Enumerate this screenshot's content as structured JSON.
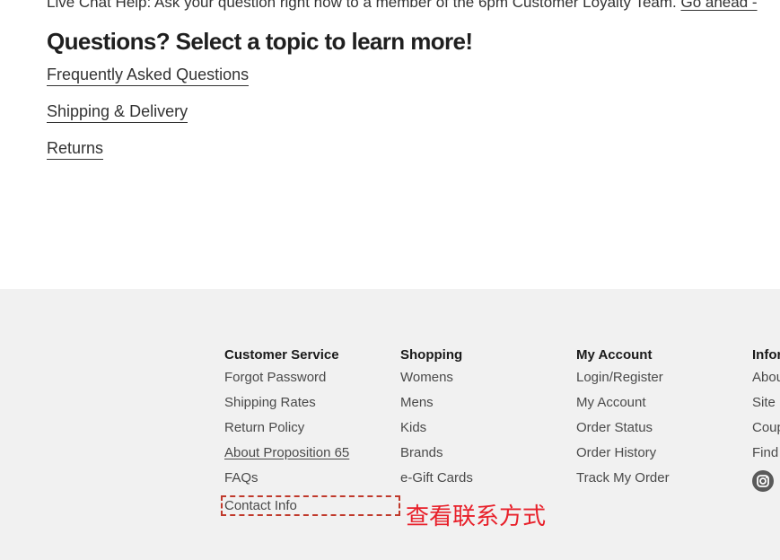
{
  "help": {
    "live_chat_text": "Live Chat Help: Ask your question right now to a member of the 6pm Customer Loyalty Team.",
    "live_chat_link": "Go ahead -",
    "topics_title": "Questions? Select a topic to learn more!",
    "topics": [
      {
        "label": "Frequently Asked Questions"
      },
      {
        "label": "Shipping & Delivery"
      },
      {
        "label": "Returns"
      }
    ]
  },
  "footer": {
    "customer_service": {
      "heading": "Customer Service",
      "items": [
        "Forgot Password",
        "Shipping Rates",
        "Return Policy",
        "About Proposition 65",
        "FAQs",
        "Contact Info"
      ]
    },
    "shopping": {
      "heading": "Shopping",
      "items": [
        "Womens",
        "Mens",
        "Kids",
        "Brands",
        "e-Gift Cards"
      ]
    },
    "my_account": {
      "heading": "My Account",
      "items": [
        "Login/Register",
        "My Account",
        "Order Status",
        "Order History",
        "Track My Order"
      ]
    },
    "info": {
      "heading": "Infor",
      "items": [
        "Abou",
        "Site M",
        "Coup",
        "Find"
      ],
      "social_icon": "instagram-icon"
    }
  },
  "annotation": {
    "text": "查看联系方式",
    "color": "#e8202a"
  },
  "colors": {
    "footer_bg": "#f1f1f1",
    "text_dark": "#1a1a1a",
    "text_link": "#4a4a4a",
    "annotation_red": "#e8202a"
  }
}
